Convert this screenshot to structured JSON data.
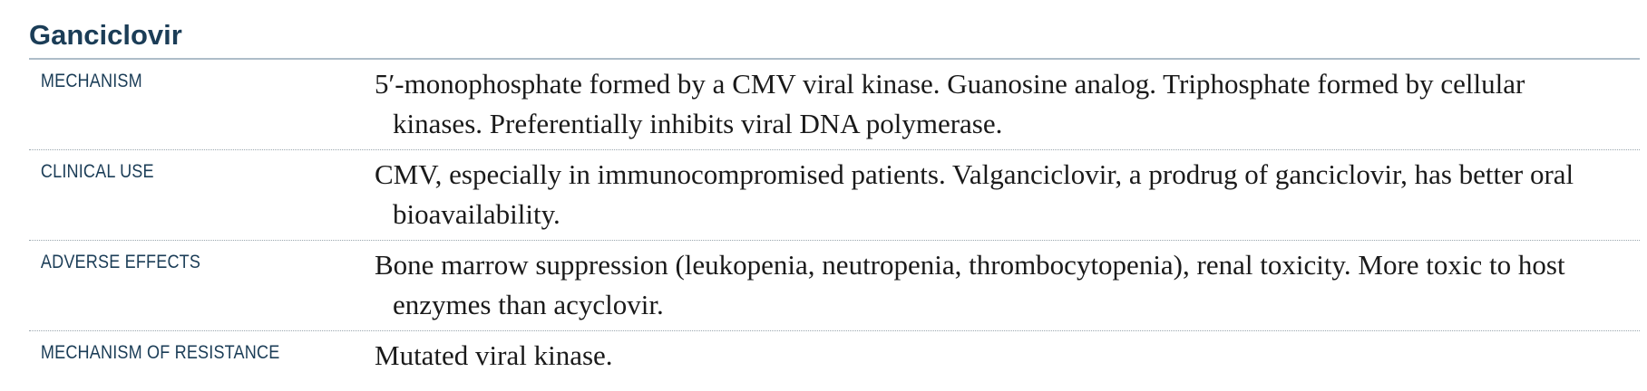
{
  "section": {
    "title": "Ganciclovir"
  },
  "rows": [
    {
      "label": "MECHANISM",
      "text": "5′-monophosphate formed by a CMV viral kinase. Guanosine analog. Triphosphate formed by cellular kinases. Preferentially inhibits viral DNA polymerase."
    },
    {
      "label": "CLINICAL USE",
      "text": "CMV, especially in immunocompromised patients. Valganciclovir, a prodrug of ganciclovir, has better oral bioavailability."
    },
    {
      "label": "ADVERSE EFFECTS",
      "text": "Bone marrow suppression (leukopenia, neutropenia, thrombocytopenia), renal toxicity. More toxic to host enzymes than acyclovir."
    },
    {
      "label": "MECHANISM OF RESISTANCE",
      "text": "Mutated viral kinase."
    }
  ],
  "colors": {
    "heading": "#1b3d57",
    "body_text": "#1a1a1a",
    "title_rule": "#aebdc8",
    "row_divider": "#9aa6ae"
  }
}
